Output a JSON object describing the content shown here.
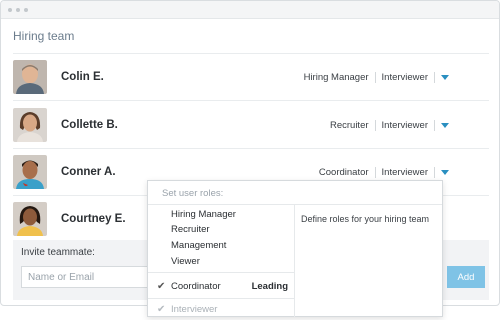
{
  "panel": {
    "title": "Hiring team"
  },
  "members": [
    {
      "name": "Colin E.",
      "roles": [
        "Hiring Manager",
        "Interviewer"
      ],
      "avatar": "man-avatar"
    },
    {
      "name": "Collette B.",
      "roles": [
        "Recruiter",
        "Interviewer"
      ],
      "avatar": "woman-avatar"
    },
    {
      "name": "Conner A.",
      "roles": [
        "Coordinator",
        "Interviewer"
      ],
      "avatar": "man-avatar"
    },
    {
      "name": "Courtney E.",
      "roles": [],
      "avatar": "woman-avatar"
    }
  ],
  "invite": {
    "label": "Invite teammate:",
    "placeholder": "Name or Email",
    "add_label": "Add"
  },
  "role_menu": {
    "header": "Set user roles:",
    "options": [
      "Hiring Manager",
      "Recruiter",
      "Management",
      "Viewer"
    ],
    "selected": {
      "label": "Coordinator",
      "badge": "Leading"
    },
    "disabled_selected": {
      "label": "Interviewer"
    },
    "help_text": "Define roles for your hiring team"
  },
  "colors": {
    "accent": "#2a8fc0",
    "add_button": "#7fc3e6",
    "title": "#6b7c8c"
  }
}
